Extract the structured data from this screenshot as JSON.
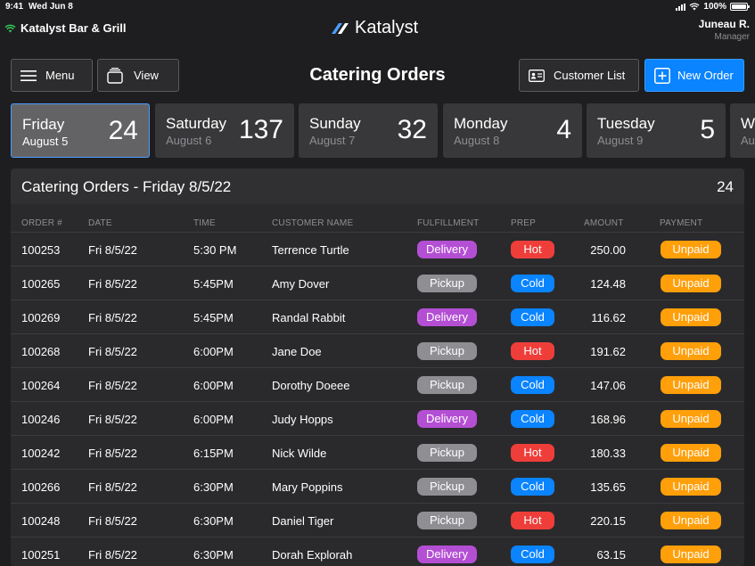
{
  "status_bar": {
    "time": "9:41",
    "date": "Wed Jun 8",
    "battery": "100%",
    "battery_level": 1.0
  },
  "header": {
    "venue": "Katalyst Bar & Grill",
    "brand": "Katalyst",
    "user_name": "Juneau R.",
    "user_role": "Manager"
  },
  "toolbar": {
    "menu_label": "Menu",
    "view_label": "View",
    "title": "Catering Orders",
    "customer_list_label": "Customer List",
    "new_order_label": "New Order"
  },
  "days": [
    {
      "name": "Friday",
      "date": "August 5",
      "count": "24",
      "active": true
    },
    {
      "name": "Saturday",
      "date": "August 6",
      "count": "137",
      "active": false
    },
    {
      "name": "Sunday",
      "date": "August 7",
      "count": "32",
      "active": false
    },
    {
      "name": "Monday",
      "date": "August 8",
      "count": "4",
      "active": false
    },
    {
      "name": "Tuesday",
      "date": "August 9",
      "count": "5",
      "active": false
    },
    {
      "name": "W",
      "date": "Au",
      "count": "",
      "active": false
    }
  ],
  "orders_panel": {
    "title": "Catering Orders - Friday 8/5/22",
    "count": "24",
    "columns": {
      "order": "ORDER #",
      "date": "DATE",
      "time": "TIME",
      "customer": "CUSTOMER NAME",
      "fulfillment": "FULFILLMENT",
      "prep": "PREP",
      "amount": "AMOUNT",
      "payment": "PAYMENT"
    },
    "rows": [
      {
        "order": "100253",
        "date": "Fri 8/5/22",
        "time": "5:30 PM",
        "customer": "Terrence Turtle",
        "fulfillment": "Delivery",
        "prep": "Hot",
        "amount": "250.00",
        "payment": "Unpaid"
      },
      {
        "order": "100265",
        "date": "Fri 8/5/22",
        "time": "5:45PM",
        "customer": "Amy Dover",
        "fulfillment": "Pickup",
        "prep": "Cold",
        "amount": "124.48",
        "payment": "Unpaid"
      },
      {
        "order": "100269",
        "date": "Fri 8/5/22",
        "time": "5:45PM",
        "customer": "Randal Rabbit",
        "fulfillment": "Delivery",
        "prep": "Cold",
        "amount": "116.62",
        "payment": "Unpaid"
      },
      {
        "order": "100268",
        "date": "Fri 8/5/22",
        "time": "6:00PM",
        "customer": "Jane Doe",
        "fulfillment": "Pickup",
        "prep": "Hot",
        "amount": "191.62",
        "payment": "Unpaid"
      },
      {
        "order": "100264",
        "date": "Fri 8/5/22",
        "time": "6:00PM",
        "customer": "Dorothy Doeee",
        "fulfillment": "Pickup",
        "prep": "Cold",
        "amount": "147.06",
        "payment": "Unpaid"
      },
      {
        "order": "100246",
        "date": "Fri 8/5/22",
        "time": "6:00PM",
        "customer": "Judy Hopps",
        "fulfillment": "Delivery",
        "prep": "Cold",
        "amount": "168.96",
        "payment": "Unpaid"
      },
      {
        "order": "100242",
        "date": "Fri 8/5/22",
        "time": "6:15PM",
        "customer": "Nick Wilde",
        "fulfillment": "Pickup",
        "prep": "Hot",
        "amount": "180.33",
        "payment": "Unpaid"
      },
      {
        "order": "100266",
        "date": "Fri 8/5/22",
        "time": "6:30PM",
        "customer": "Mary Poppins",
        "fulfillment": "Pickup",
        "prep": "Cold",
        "amount": "135.65",
        "payment": "Unpaid"
      },
      {
        "order": "100248",
        "date": "Fri 8/5/22",
        "time": "6:30PM",
        "customer": "Daniel Tiger",
        "fulfillment": "Pickup",
        "prep": "Hot",
        "amount": "220.15",
        "payment": "Unpaid"
      },
      {
        "order": "100251",
        "date": "Fri 8/5/22",
        "time": "6:30PM",
        "customer": "Dorah Explorah",
        "fulfillment": "Delivery",
        "prep": "Cold",
        "amount": "63.15",
        "payment": "Unpaid"
      }
    ]
  },
  "colors": {
    "accent": "#0a84ff",
    "delivery": "#b44fd4",
    "pickup": "#8e8e93",
    "hot": "#ef3e3a",
    "cold": "#0a84ff",
    "unpaid": "#ff9f0a"
  },
  "icons": {
    "wifi": "wifi-icon",
    "brand": "katalyst-logo-icon",
    "menu": "hamburger-menu-icon",
    "view": "view-stack-icon",
    "customer_list": "contact-card-icon",
    "new_order": "plus-square-icon"
  }
}
